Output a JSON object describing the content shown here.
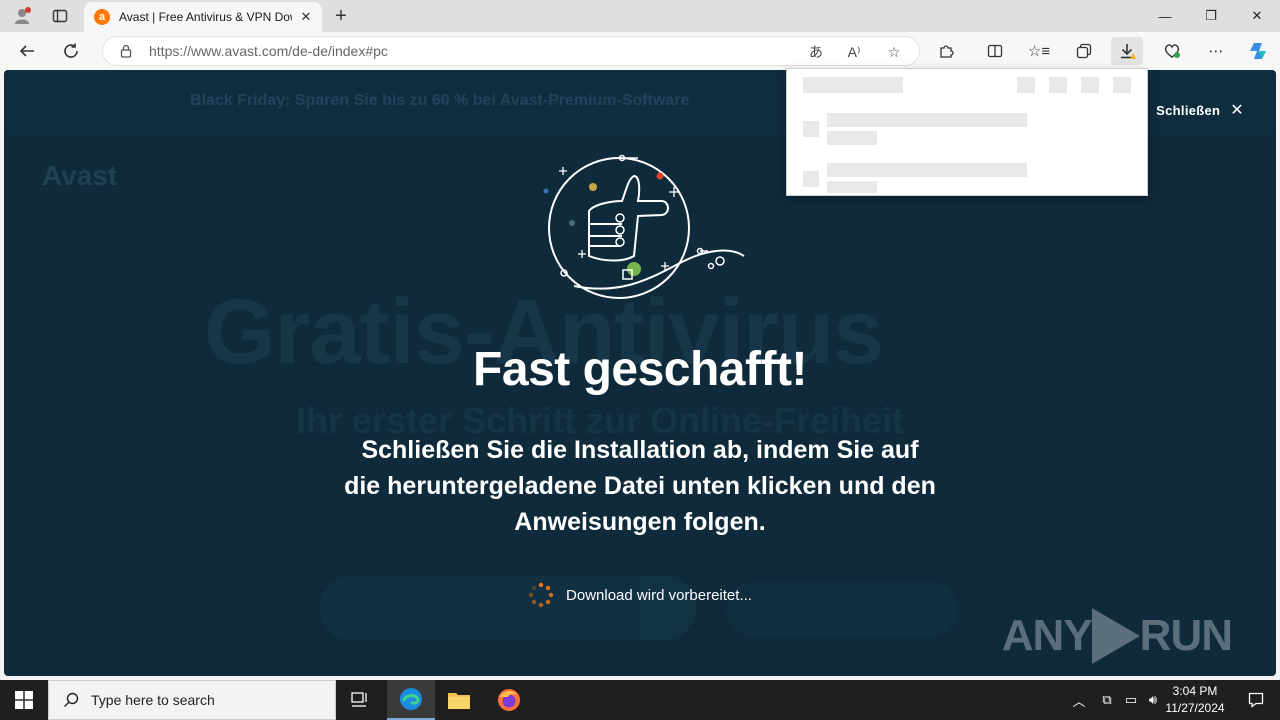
{
  "browser": {
    "tab_title": "Avast | Free Antivirus & VPN Dow",
    "favicon_letter": "a",
    "url_prefix": "https://www.avast.com",
    "url_path": "/de-de/index#pc"
  },
  "page": {
    "banner_text": "Black Friday: Sparen Sie bis zu 60 % bei Avast-Premium-Software",
    "banner_close_label": "Schließen",
    "background_logo": "Avast",
    "background_heading": "Gratis-Antivirus",
    "background_subheading": "Ihr erster Schritt zur Online-Freiheit",
    "headline": "Fast geschafft!",
    "instructions": "Schließen Sie die Installation ab, indem Sie auf die heruntergeladene Datei unten klicken und den Anweisungen folgen.",
    "status": "Download wird vorbereitet...",
    "watermark_left": "ANY",
    "watermark_right": "RUN"
  },
  "taskbar": {
    "search_placeholder": "Type here to search",
    "time": "3:04 PM",
    "date": "11/27/2024"
  },
  "colors": {
    "overlay_bg": "#0f2a3b",
    "accent_orange": "#ff7800",
    "illustration_green": "#74b64a",
    "illustration_red": "#d9452c"
  }
}
